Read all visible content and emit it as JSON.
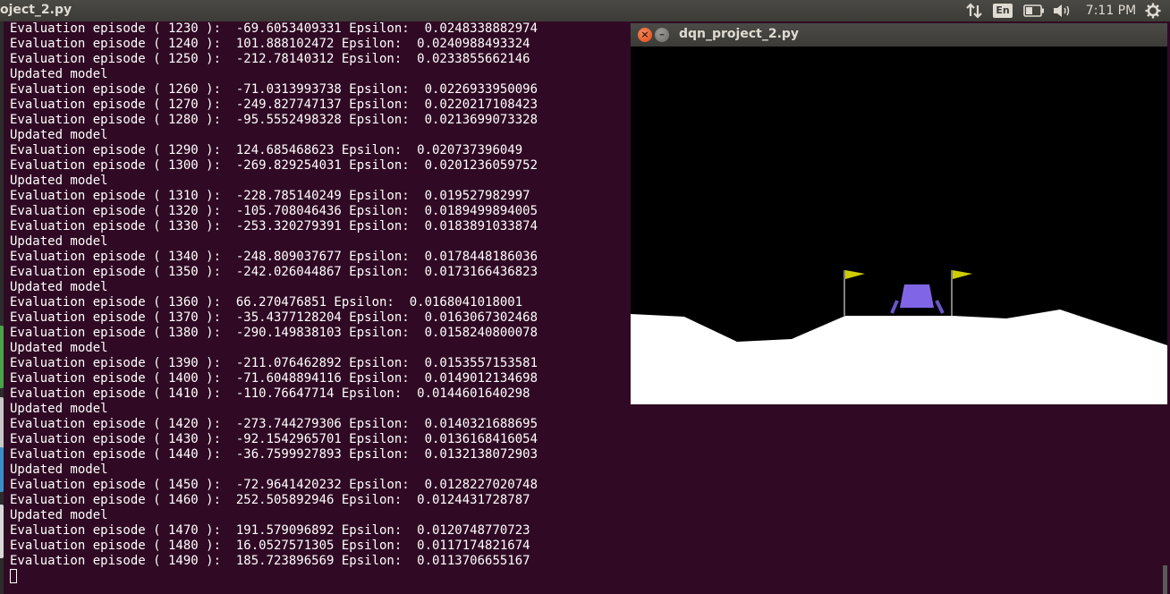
{
  "panel": {
    "title": "oject_2.py",
    "keyboard_layout": "En",
    "clock": "7:11 PM",
    "icons": [
      "network-arrows-icon",
      "keyboard-layout-icon",
      "battery-icon",
      "volume-icon",
      "gear-icon"
    ]
  },
  "terminal": {
    "lines": [
      "Evaluation episode ( 1230 ):  -69.6053409331 Epsilon:  0.0248338882974",
      "Evaluation episode ( 1240 ):  101.888102472 Epsilon:  0.0240988493324",
      "Evaluation episode ( 1250 ):  -212.78140312 Epsilon:  0.0233855662146",
      "Updated model",
      "Evaluation episode ( 1260 ):  -71.0313993738 Epsilon:  0.0226933950096",
      "Evaluation episode ( 1270 ):  -249.827747137 Epsilon:  0.0220217108423",
      "Evaluation episode ( 1280 ):  -95.5552498328 Epsilon:  0.0213699073328",
      "Updated model",
      "Evaluation episode ( 1290 ):  124.685468623 Epsilon:  0.020737396049",
      "Evaluation episode ( 1300 ):  -269.829254031 Epsilon:  0.0201236059752",
      "Updated model",
      "Evaluation episode ( 1310 ):  -228.785140249 Epsilon:  0.019527982997",
      "Evaluation episode ( 1320 ):  -105.708046436 Epsilon:  0.0189499894005",
      "Evaluation episode ( 1330 ):  -253.320279391 Epsilon:  0.0183891033874",
      "Updated model",
      "Evaluation episode ( 1340 ):  -248.809037677 Epsilon:  0.0178448186036",
      "Evaluation episode ( 1350 ):  -242.026044867 Epsilon:  0.0173166436823",
      "Updated model",
      "Evaluation episode ( 1360 ):  66.270476851 Epsilon:  0.0168041018001",
      "Evaluation episode ( 1370 ):  -35.4377128204 Epsilon:  0.0163067302468",
      "Evaluation episode ( 1380 ):  -290.149838103 Epsilon:  0.0158240800078",
      "Updated model",
      "Evaluation episode ( 1390 ):  -211.076462892 Epsilon:  0.0153557153581",
      "Evaluation episode ( 1400 ):  -71.6048894116 Epsilon:  0.0149012134698",
      "Evaluation episode ( 1410 ):  -110.76647714 Epsilon:  0.0144601640298",
      "Updated model",
      "Evaluation episode ( 1420 ):  -273.744279306 Epsilon:  0.0140321688695",
      "Evaluation episode ( 1430 ):  -92.1542965701 Epsilon:  0.0136168416054",
      "Evaluation episode ( 1440 ):  -36.7599927893 Epsilon:  0.0132138072903",
      "Updated model",
      "Evaluation episode ( 1450 ):  -72.9641420232 Epsilon:  0.0128227020748",
      "Evaluation episode ( 1460 ):  252.505892946 Epsilon:  0.0124431728787",
      "Updated model",
      "Evaluation episode ( 1470 ):  191.579096892 Epsilon:  0.0120748770723",
      "Evaluation episode ( 1480 ):  16.0527571305 Epsilon:  0.0117174821674",
      "Evaluation episode ( 1490 ):  185.723896569 Epsilon:  0.0113706655167"
    ]
  },
  "game_window": {
    "title": "dqn_project_2.py",
    "close_glyph": "×",
    "minimize_glyph": "–",
    "colors": {
      "sky": "#000000",
      "terrain": "#ffffff",
      "flag": "#cccc00",
      "lander_body": "#8066e6",
      "lander_legs": "#6a55c8"
    }
  },
  "colors": {
    "terminal_bg": "#300a24",
    "terminal_fg": "#ffffff",
    "panel_bg": "#3c3b37"
  }
}
